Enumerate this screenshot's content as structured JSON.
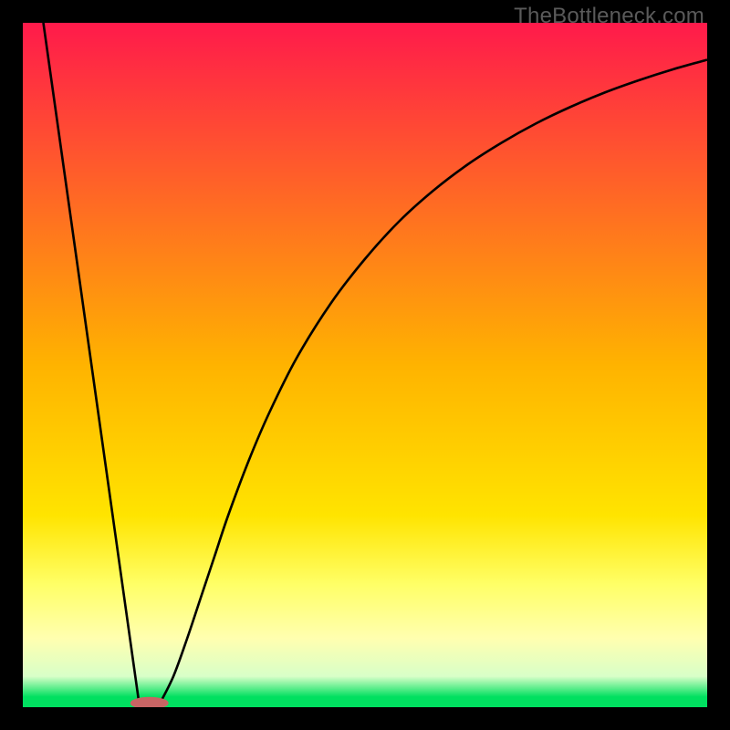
{
  "watermark": "TheBottleneck.com",
  "chart_data": {
    "type": "line",
    "title": "",
    "xlabel": "",
    "ylabel": "",
    "xlim": [
      0,
      100
    ],
    "ylim": [
      0,
      100
    ],
    "background_gradient": {
      "stops": [
        {
          "offset": 0.0,
          "color": "#ff1a4b"
        },
        {
          "offset": 0.5,
          "color": "#ffb300"
        },
        {
          "offset": 0.72,
          "color": "#ffe400"
        },
        {
          "offset": 0.82,
          "color": "#ffff66"
        },
        {
          "offset": 0.9,
          "color": "#ffffb0"
        },
        {
          "offset": 0.955,
          "color": "#d8ffc8"
        },
        {
          "offset": 0.985,
          "color": "#00e060"
        },
        {
          "offset": 1.0,
          "color": "#00e060"
        }
      ]
    },
    "series": [
      {
        "name": "left-line",
        "x": [
          3.0,
          17.0
        ],
        "y": [
          100.0,
          0.5
        ]
      },
      {
        "name": "right-curve",
        "x": [
          20.0,
          22,
          24,
          26,
          28,
          30,
          33,
          36,
          40,
          45,
          50,
          55,
          60,
          65,
          70,
          75,
          80,
          85,
          90,
          95,
          100
        ],
        "y": [
          0.5,
          4.5,
          10,
          16,
          22,
          28,
          36,
          43,
          51,
          59,
          65.5,
          71,
          75.5,
          79.3,
          82.5,
          85.3,
          87.7,
          89.8,
          91.6,
          93.2,
          94.6
        ]
      }
    ],
    "marker": {
      "cx": 18.5,
      "cy": 0.6,
      "rx": 2.8,
      "ry": 0.9,
      "fill": "#c86464"
    }
  }
}
